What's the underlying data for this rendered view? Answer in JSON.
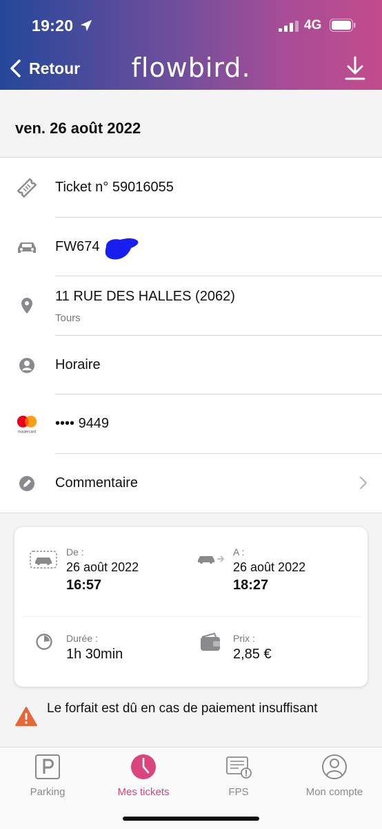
{
  "status": {
    "time": "19:20",
    "network": "4G"
  },
  "nav": {
    "back_label": "Retour",
    "logo": "flowbird."
  },
  "date": "ven. 26 août 2022",
  "ticket": {
    "number": "Ticket n° 59016055",
    "plate": "FW674",
    "address": "11 RUE DES HALLES (2062)",
    "city": "Tours",
    "tariff": "Horaire",
    "card": "•••• 9449",
    "card_brand": "mastercard",
    "comment": "Commentaire"
  },
  "summary": {
    "from_label": "De :",
    "from_date": "26 août 2022",
    "from_time": "16:57",
    "to_label": "A :",
    "to_date": "26 août 2022",
    "to_time": "18:27",
    "duration_label": "Durée :",
    "duration": "1h 30min",
    "price_label": "Prix :",
    "price": "2,85 €"
  },
  "warning": "Le forfait est dû en cas de paiement insuffisant",
  "tabs": [
    {
      "label": "Parking"
    },
    {
      "label": "Mes tickets"
    },
    {
      "label": "FPS"
    },
    {
      "label": "Mon compte"
    }
  ],
  "colors": {
    "accent": "#d9457c",
    "icon_gray": "#8a8a8e",
    "warning": "#e5673c"
  }
}
